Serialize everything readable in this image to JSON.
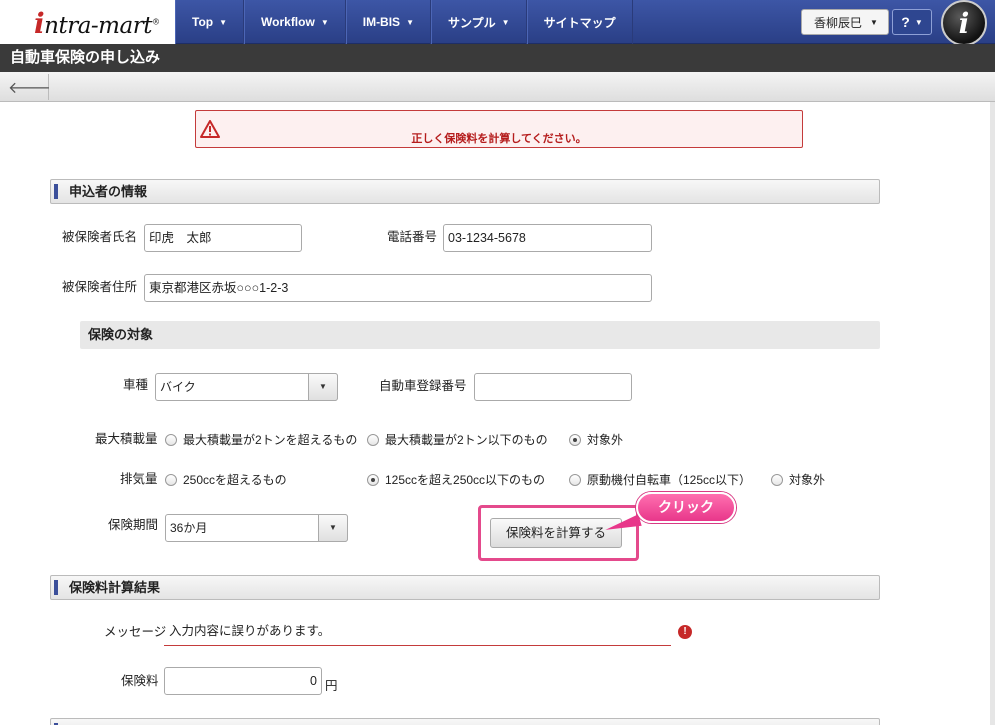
{
  "header": {
    "logo": "intra-mart",
    "nav": [
      "Top",
      "Workflow",
      "IM-BIS",
      "サンプル",
      "サイトマップ"
    ],
    "user_name": "香柳辰巳",
    "help": "?",
    "info_icon": "i"
  },
  "page_title": "自動車保険の申し込み",
  "error_banner": "正しく保険料を計算してください。",
  "sections": {
    "applicant": "申込者の情報",
    "target": "保険の対象",
    "result": "保険料計算結果"
  },
  "applicant": {
    "name_label": "被保険者氏名",
    "name_value": "印虎　太郎",
    "phone_label": "電話番号",
    "phone_value": "03-1234-5678",
    "address_label": "被保険者住所",
    "address_value": "東京都港区赤坂○○○1-2-3"
  },
  "target": {
    "vehicle_label": "車種",
    "vehicle_value": "バイク",
    "reg_label": "自動車登録番号",
    "reg_value": "",
    "load_label": "最大積載量",
    "load_options": [
      "最大積載量が2トンを超えるもの",
      "最大積載量が2トン以下のもの",
      "対象外"
    ],
    "load_selected": 2,
    "cc_label": "排気量",
    "cc_options": [
      "250ccを超えるもの",
      "125ccを超え250cc以下のもの",
      "原動機付自転車（125cc以下）",
      "対象外"
    ],
    "cc_selected": 1,
    "period_label": "保険期間",
    "period_value": "36か月",
    "calc_button": "保険料を計算する",
    "callout": "クリック"
  },
  "result": {
    "message_label": "メッセージ",
    "message_value": "入力内容に誤りがあります。",
    "premium_label": "保険料",
    "premium_value": "0",
    "premium_unit": "円"
  }
}
